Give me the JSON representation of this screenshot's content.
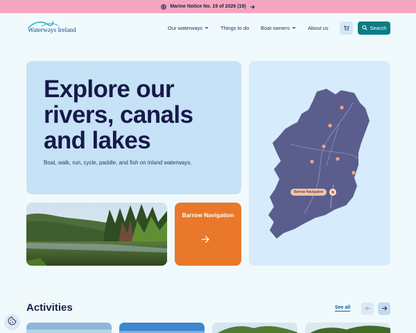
{
  "notice": {
    "text": "Marine Notice No. 19 of 2026 (19)"
  },
  "header": {
    "logo_text": "Waterways Ireland",
    "nav": [
      {
        "label": "Our waterways",
        "has_dropdown": true
      },
      {
        "label": "Things to do",
        "has_dropdown": false
      },
      {
        "label": "Boat owners",
        "has_dropdown": true
      },
      {
        "label": "About us",
        "has_dropdown": false
      }
    ],
    "search_label": "Search"
  },
  "hero": {
    "title": "Explore our rivers, canals and lakes",
    "subtitle": "Boat, walk, run, cycle, paddle, and fish on inland waterways."
  },
  "feature": {
    "title": "Barrow Navigation"
  },
  "map": {
    "active_label": "Barrow Navigation"
  },
  "activities": {
    "title": "Activities",
    "see_all": "See all"
  },
  "icons": [
    "warning-icon",
    "arrow-right-icon",
    "chevron-down-icon",
    "cart-icon",
    "search-icon",
    "arrow-left-icon",
    "cookie-icon"
  ],
  "colors": {
    "notice_bg": "#f4a6be",
    "accent": "#0b7c84",
    "orange": "#e9782b",
    "hero_bg": "#c6e2f6",
    "map_land": "#5b5e8c"
  }
}
